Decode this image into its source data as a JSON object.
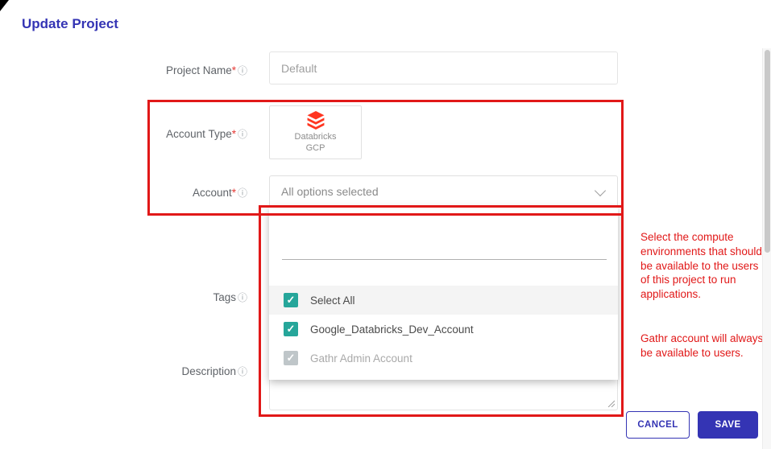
{
  "title": "Update Project",
  "icons": {
    "info": "ⓘ",
    "check": "✓"
  },
  "fields": {
    "project_name": {
      "label": "Project Name",
      "required": "*",
      "placeholder": "Default"
    },
    "account_type": {
      "label": "Account Type",
      "required": "*",
      "card": {
        "line1": "Databricks",
        "line2": "GCP"
      }
    },
    "account": {
      "label": "Account",
      "required": "*",
      "value": "All options selected"
    },
    "tags": {
      "label": "Tags"
    },
    "description": {
      "label": "Description"
    }
  },
  "dropdown": {
    "options": [
      {
        "label": "Select All",
        "checked": true,
        "disabled": false
      },
      {
        "label": "Google_Databricks_Dev_Account",
        "checked": true,
        "disabled": false
      },
      {
        "label": "Gathr Admin Account",
        "checked": true,
        "disabled": true
      }
    ]
  },
  "annotations": {
    "note1": "Select the compute environments that should be available to the users of this project to run applications.",
    "note2": "Gathr account will always be available to users."
  },
  "actions": {
    "cancel": "CANCEL",
    "save": "SAVE"
  },
  "colors": {
    "accent": "#3434b4",
    "annotation": "#e11818",
    "checkbox": "#26a69a",
    "databricks": "#ff3621"
  }
}
